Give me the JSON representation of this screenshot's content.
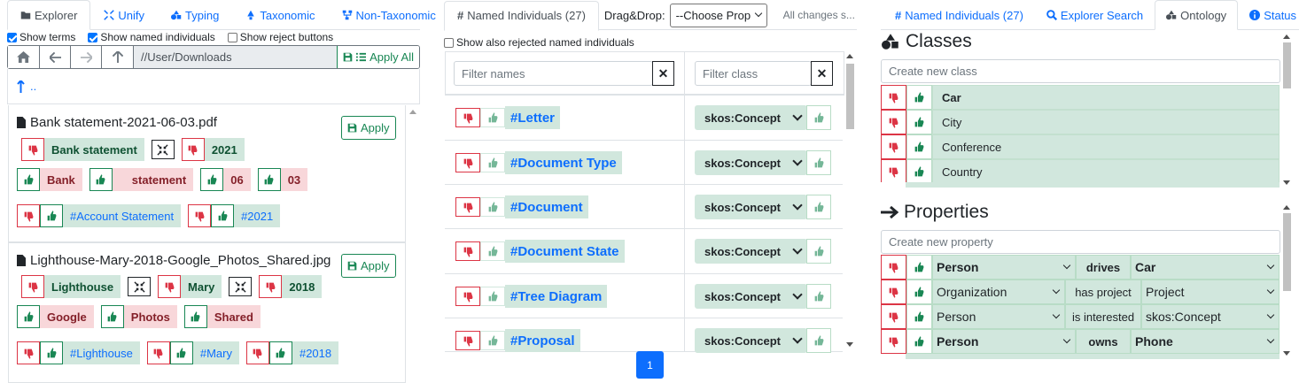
{
  "left_tabs": [
    {
      "label": "Explorer",
      "icon": "folder-icon"
    },
    {
      "label": "Unify",
      "icon": "compress-icon"
    },
    {
      "label": "Typing",
      "icon": "shapes-icon"
    },
    {
      "label": "Taxonomic",
      "icon": "tag-icon"
    },
    {
      "label": "Non-Taxonomic",
      "icon": "network-icon"
    }
  ],
  "options": {
    "show_terms": "Show terms",
    "show_named": "Show named individuals",
    "show_reject": "Show reject buttons"
  },
  "path": "//User/Downloads",
  "apply_all": "Apply All",
  "parent_dir": "..",
  "apply": "Apply",
  "files": [
    {
      "name": "Bank statement-2021-06-03.pdf",
      "row1": [
        "Bank statement",
        "2021"
      ],
      "row2": [
        "Bank",
        "statement",
        "06",
        "03"
      ],
      "row3": [
        "#Account Statement",
        "#2021"
      ]
    },
    {
      "name": "Lighthouse-Mary-2018-Google_Photos_Shared.jpg",
      "row1": [
        "Lighthouse",
        "Mary",
        "2018"
      ],
      "row2": [
        "Google",
        "Photos",
        "Shared"
      ],
      "row3": [
        "#Lighthouse",
        "#Mary",
        "#2018"
      ]
    }
  ],
  "mid": {
    "tab": "Named Individuals (27)",
    "dragdrop_label": "Drag&Drop:",
    "dragdrop_select": "--Choose Prop",
    "status": "All changes s...",
    "show_rejected": "Show also rejected named individuals",
    "filter_names": "Filter names",
    "filter_class": "Filter class",
    "rows": [
      {
        "name": "#Letter",
        "cls": "skos:Concept"
      },
      {
        "name": "#Document Type",
        "cls": "skos:Concept"
      },
      {
        "name": "#Document",
        "cls": "skos:Concept"
      },
      {
        "name": "#Document State",
        "cls": "skos:Concept"
      },
      {
        "name": "#Tree Diagram",
        "cls": "skos:Concept"
      },
      {
        "name": "#Proposal",
        "cls": "skos:Concept"
      }
    ],
    "page": "1"
  },
  "right_tabs": [
    {
      "label": "Named Individuals (27)",
      "icon": "hash-icon"
    },
    {
      "label": "Explorer Search",
      "icon": "search-icon"
    },
    {
      "label": "Ontology",
      "icon": "shapes-icon"
    },
    {
      "label": "Status",
      "icon": "info-icon"
    }
  ],
  "classes": {
    "title": "Classes",
    "placeholder": "Create new class",
    "items": [
      "Car",
      "City",
      "Conference",
      "Country"
    ]
  },
  "properties": {
    "title": "Properties",
    "placeholder": "Create new property",
    "items": [
      {
        "s": "Person",
        "v": "drives",
        "o": "Car",
        "bold": true
      },
      {
        "s": "Organization",
        "v": "has project",
        "o": "Project",
        "bold": false
      },
      {
        "s": "Person",
        "v": "is interested",
        "o": "skos:Concept",
        "bold": false
      },
      {
        "s": "Person",
        "v": "owns",
        "o": "Phone",
        "bold": true
      }
    ]
  },
  "colors": {
    "accent": "#0d6efd",
    "success": "#198754",
    "danger": "#dc3545",
    "green_bg": "#d1e7dd",
    "red_bg": "#f8d7da"
  }
}
